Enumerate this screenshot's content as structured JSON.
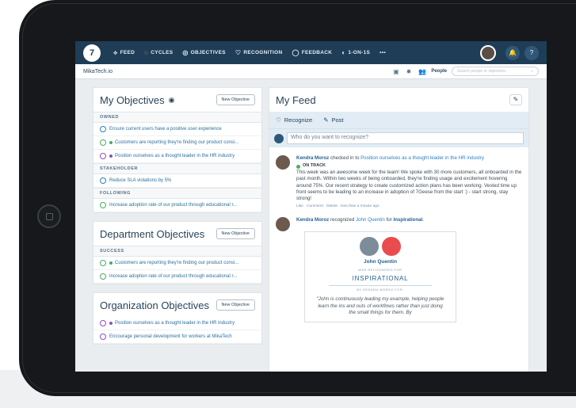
{
  "nav": {
    "logo": "7",
    "items": [
      {
        "icon": "feed-icon",
        "glyph": "⟡",
        "label": "FEED"
      },
      {
        "icon": "cycles-icon",
        "glyph": "◌",
        "label": "CYCLES"
      },
      {
        "icon": "objectives-icon",
        "glyph": "◎",
        "label": "OBJECTIVES"
      },
      {
        "icon": "recognition-icon",
        "glyph": "♡",
        "label": "RECOGNITION"
      },
      {
        "icon": "feedback-icon",
        "glyph": "◯",
        "label": "FEEDBACK"
      },
      {
        "icon": "one-on-one-icon",
        "glyph": "◐",
        "label": "1-ON-1S"
      }
    ],
    "more": "•••",
    "bell": "🔔",
    "help": "?"
  },
  "subbar": {
    "org_name": "MikaTech.io",
    "people_label": "People",
    "search_placeholder": "Search people or objectives",
    "search_glyph": "⌕"
  },
  "my_objectives": {
    "title": "My Objectives",
    "eye_glyph": "◉",
    "button": "New Objective",
    "sections": [
      {
        "label": "OWNED",
        "rows": [
          {
            "status": "blue",
            "dot": "",
            "text": "Ensure current users have a positive user experience"
          },
          {
            "status": "green",
            "dot": "green",
            "text": "Customers are reporting they're finding our product consi..."
          },
          {
            "status": "purple",
            "dot": "purple",
            "text": "Position ourselves as a thought leader in the HR industry"
          }
        ]
      },
      {
        "label": "STAKEHOLDER",
        "rows": [
          {
            "status": "blue",
            "dot": "",
            "text": "Reduce SLA violations by 5%"
          }
        ]
      },
      {
        "label": "FOLLOWING",
        "rows": [
          {
            "status": "green",
            "dot": "",
            "text": "Increase adoption rate of our product through educational r..."
          }
        ]
      }
    ]
  },
  "department_objectives": {
    "title": "Department Objectives",
    "button": "New Objective",
    "section_label": "SUCCESS",
    "rows": [
      {
        "status": "green",
        "dot": "green",
        "text": "Customers are reporting they're finding our product consi..."
      },
      {
        "status": "green",
        "dot": "",
        "text": "Increase adoption rate of our product through educational r..."
      }
    ]
  },
  "organization_objectives": {
    "title": "Organization Objectives",
    "button": "New Objective",
    "rows": [
      {
        "status": "purple",
        "dot": "purple",
        "text": "Position ourselves as a thought leader in the HR industry"
      },
      {
        "status": "purple",
        "dot": "",
        "text": "Encourage personal development for workers at MikaTech"
      }
    ]
  },
  "feed": {
    "title": "My Feed",
    "tool_glyph": "✎",
    "tabs": [
      {
        "icon": "recognize-icon",
        "glyph": "♡",
        "label": "Recognize"
      },
      {
        "icon": "post-icon",
        "glyph": "✎",
        "label": "Post"
      }
    ],
    "recognize_placeholder": "Who do you want to recognize?",
    "post1": {
      "author": "Kendra Moroz",
      "action": " checked in to ",
      "objective": "Position ourselves as a thought leader in the HR industry",
      "status": "ON TRACK",
      "body": "This week was an awesome week for the team! We spoke with 30 more customers, all onboarded in the past month. Within two weeks of being onboarded, they're finding usage and excitement hovering around 75%. Our recent strategy to create customized action plans has been working. Vested time up front seems to be leading to an increase in adoption of 7Geese from the start :) - start strong, stay strong!",
      "meta": "Like · Comment · Delete · less than a minute ago"
    },
    "post2": {
      "author": "Kendra Moroz",
      "action": " recognized ",
      "recipient": "John Quentin",
      "for_word": " for ",
      "value": "Inspirational",
      "end": "."
    },
    "recognition_card": {
      "name": "John Quentin",
      "was_recognized": "WAS RECOGNIZED FOR",
      "value": "INSPIRATIONAL",
      "by": "BY KENDRA MOROZ FOR:",
      "quote": "\"John is continuously leading my example, helping people learn the ins and outs of workflows rather than just doing the small things for them. By"
    }
  }
}
